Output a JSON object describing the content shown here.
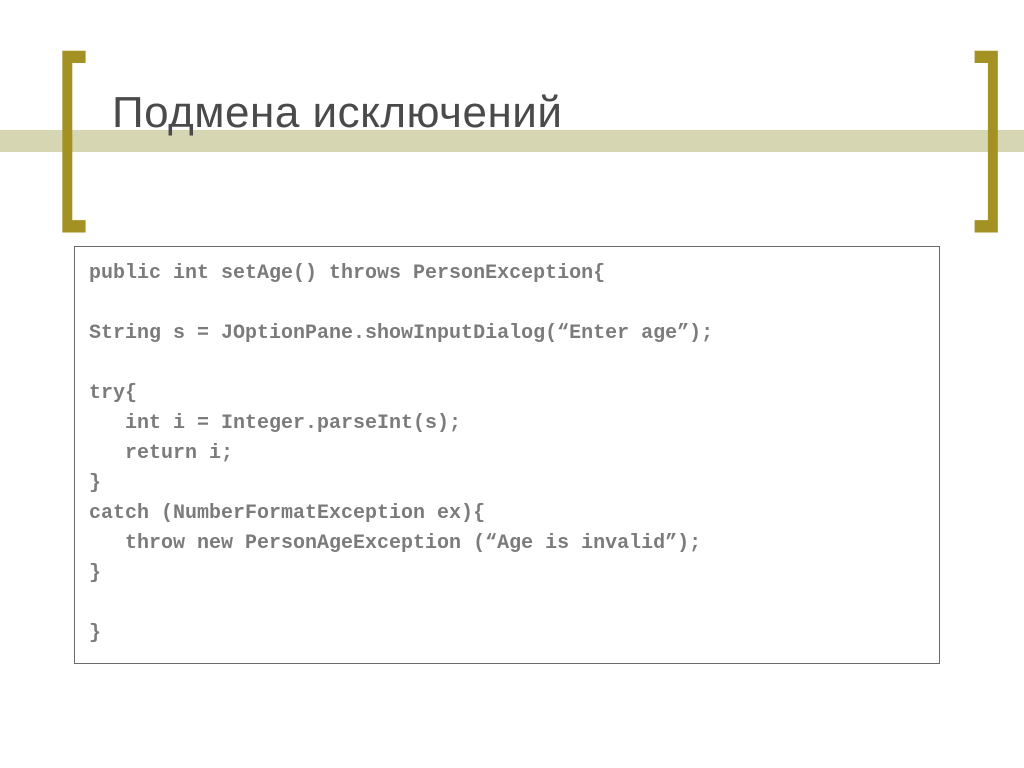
{
  "title": "Подмена исключений",
  "code": "public int setAge() throws PersonException{\n\nString s = JOptionPane.showInputDialog(“Enter age”);\n\ntry{\n   int i = Integer.parseInt(s);\n   return i;\n}\ncatch (NumberFormatException ex){\n   throw new PersonAgeException (“Age is invalid”);\n}\n\n}"
}
